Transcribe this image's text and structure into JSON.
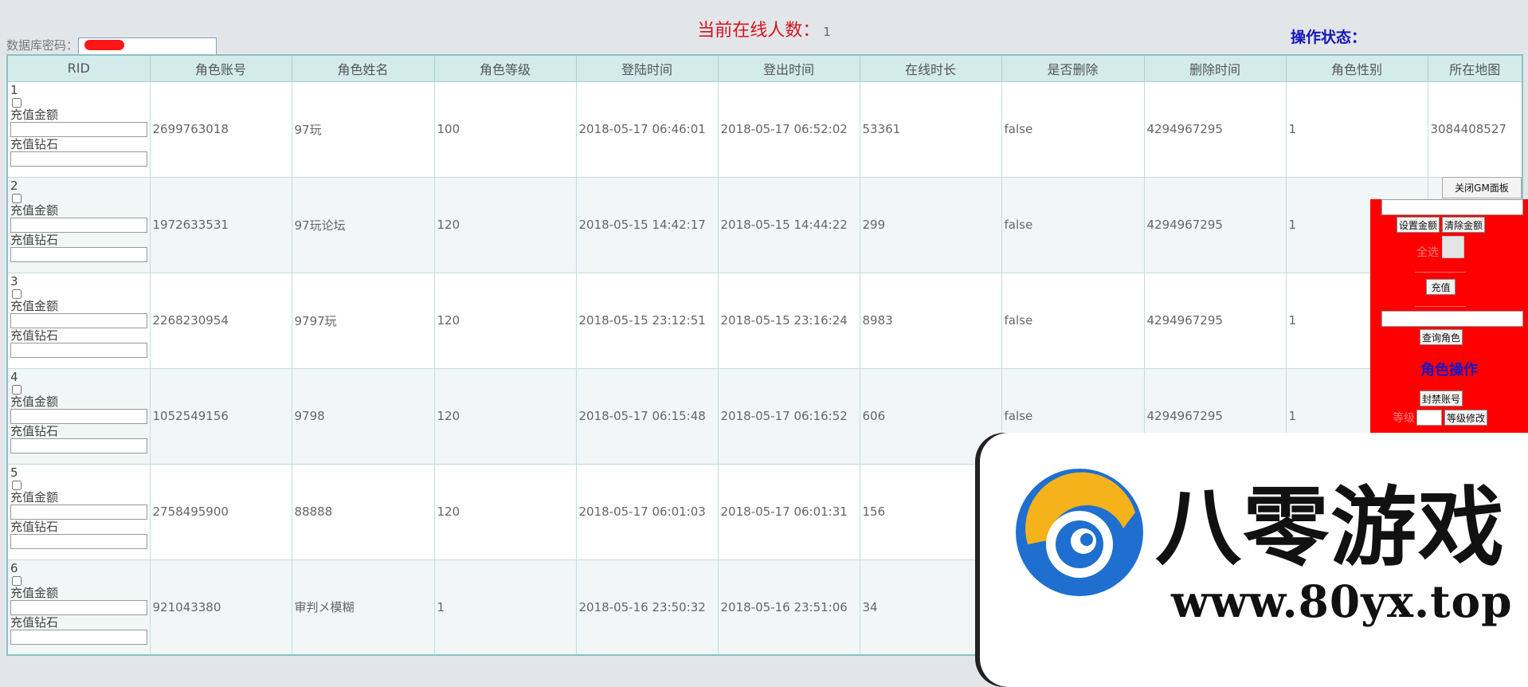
{
  "header": {
    "online_label": "当前在线人数：",
    "online_count": "1",
    "db_password_label": "数据库密码：",
    "operation_status_label": "操作状态："
  },
  "table": {
    "columns": [
      "RID",
      "角色账号",
      "角色姓名",
      "角色等级",
      "登陆时间",
      "登出时间",
      "在线时长",
      "是否删除",
      "删除时间",
      "角色性别",
      "所在地图"
    ],
    "recharge_amount_label": "充值金额",
    "recharge_diamond_label": "充值钻石",
    "rows": [
      {
        "rid": "1",
        "account": "2699763018",
        "name": "97玩",
        "level": "100",
        "login": "2018-05-17 06:46:01",
        "logout": "2018-05-17 06:52:02",
        "online": "53361",
        "deleted": "false",
        "delete_time": "4294967295",
        "gender": "1",
        "map": "3084408527"
      },
      {
        "rid": "2",
        "account": "1972633531",
        "name": "97玩论坛",
        "level": "120",
        "login": "2018-05-15 14:42:17",
        "logout": "2018-05-15 14:44:22",
        "online": "299",
        "deleted": "false",
        "delete_time": "4294967295",
        "gender": "1",
        "map": ""
      },
      {
        "rid": "3",
        "account": "2268230954",
        "name": "9797玩",
        "level": "120",
        "login": "2018-05-15 23:12:51",
        "logout": "2018-05-15 23:16:24",
        "online": "8983",
        "deleted": "false",
        "delete_time": "4294967295",
        "gender": "1",
        "map": ""
      },
      {
        "rid": "4",
        "account": "1052549156",
        "name": "9798",
        "level": "120",
        "login": "2018-05-17 06:15:48",
        "logout": "2018-05-17 06:16:52",
        "online": "606",
        "deleted": "false",
        "delete_time": "4294967295",
        "gender": "1",
        "map": ""
      },
      {
        "rid": "5",
        "account": "2758495900",
        "name": "88888",
        "level": "120",
        "login": "2018-05-17 06:01:03",
        "logout": "2018-05-17 06:01:31",
        "online": "156",
        "deleted": "",
        "delete_time": "",
        "gender": "",
        "map": ""
      },
      {
        "rid": "6",
        "account": "921043380",
        "name": "审判メ模糊",
        "level": "1",
        "login": "2018-05-16 23:50:32",
        "logout": "2018-05-16 23:51:06",
        "online": "34",
        "deleted": "",
        "delete_time": "",
        "gender": "",
        "map": ""
      }
    ]
  },
  "gm_panel": {
    "close_label": "关闭GM面板",
    "set_amount_label": "设置金额",
    "clear_amount_label": "清除金额",
    "select_all_label": "全选",
    "recharge_label": "充值",
    "query_role_label": "查询角色",
    "role_ops_title": "角色操作",
    "ban_account_label": "封禁账号",
    "level_label": "等级",
    "level_modify_label": "等级修改",
    "accent_color": "#ff0000"
  },
  "watermark": {
    "brand_text": "八零游戏",
    "url_text": "www.80yx.top"
  }
}
